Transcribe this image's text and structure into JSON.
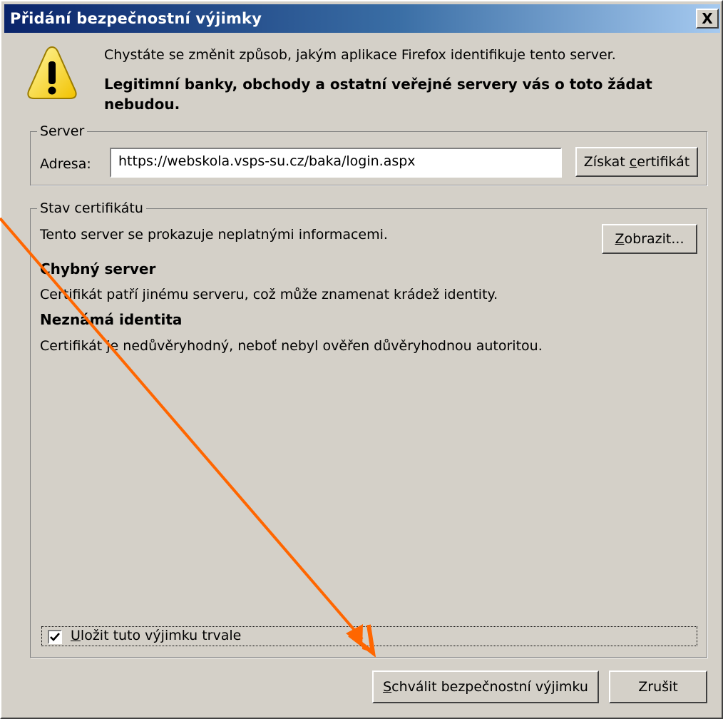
{
  "dialog": {
    "title": "Přidání bezpečnostní výjimky",
    "close_label": "X"
  },
  "intro": {
    "text": "Chystáte se změnit způsob, jakým aplikace Firefox identifikuje tento server.",
    "warning_bold": "Legitimní banky, obchody a ostatní veřejné servery vás o toto žádat nebudou."
  },
  "server": {
    "legend": "Server",
    "address_label": "Adresa:",
    "address_value": "https://webskola.vsps-su.cz/baka/login.aspx",
    "get_cert_button": {
      "before": "Získat ",
      "key": "c",
      "after": "ertifikát"
    }
  },
  "cert_status": {
    "legend": "Stav certifikátu",
    "summary": "Tento server se prokazuje neplatnými informacemi.",
    "view_button": {
      "before": "",
      "key": "Z",
      "after": "obrazit..."
    },
    "issues": [
      {
        "title": "Chybný server",
        "text": "Certifikát patří jinému serveru, což může znamenat krádež identity."
      },
      {
        "title": "Neznámá identita",
        "text": "Certifikát je nedůvěryhodný, neboť nebyl ověřen důvěryhodnou autoritou."
      }
    ]
  },
  "save_exception": {
    "checked": true,
    "label": {
      "before": "",
      "key": "U",
      "after": "ložit tuto výjimku trvale"
    }
  },
  "buttons": {
    "confirm": {
      "before": "",
      "key": "S",
      "after": "chválit bezpečnostní výjimku"
    },
    "cancel": "Zrušit"
  },
  "colors": {
    "arrow": "#ff6600",
    "title_bar_start": "#0a246a",
    "title_bar_end": "#a6caf0",
    "dialog_background": "#d4d0c8"
  },
  "icons": {
    "warning": "warning-triangle-icon",
    "close": "close-icon",
    "checkbox": "checkmark-icon"
  }
}
